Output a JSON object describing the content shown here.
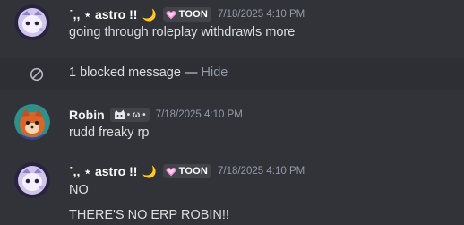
{
  "messages": [
    {
      "username": "˙,, ⋆ astro !!",
      "moon": "🌙",
      "tag": "TOON",
      "timestamp": "7/18/2025 4:10 PM",
      "lines": [
        "going through roleplay withdrawls more"
      ]
    },
    {
      "username": "Robin",
      "tag": "• ω •",
      "timestamp": "7/18/2025 4:10 PM",
      "lines": [
        "rudd freaky rp"
      ]
    },
    {
      "username": "˙,, ⋆ astro !!",
      "moon": "🌙",
      "tag": "TOON",
      "timestamp": "7/18/2025 4:10 PM",
      "lines": [
        "NO",
        "THERE'S NO ERP ROBIN!!"
      ]
    }
  ],
  "blocked": {
    "label": "1 blocked message",
    "separator": " — ",
    "action": "Hide"
  },
  "colors": {
    "background": "#323339",
    "blocked_row": "#2e2f35",
    "tag_bg": "#43434a",
    "timestamp": "#949ba4",
    "tag_heart": "#f28bd0"
  }
}
